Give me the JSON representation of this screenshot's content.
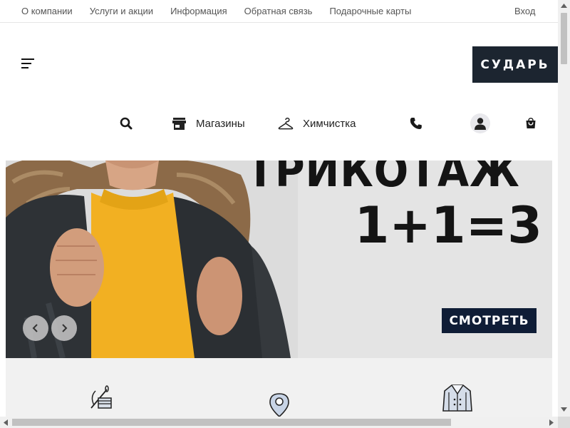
{
  "topnav": {
    "items": [
      {
        "label": "О компании"
      },
      {
        "label": "Услуги и акции"
      },
      {
        "label": "Информация"
      },
      {
        "label": "Обратная связь"
      },
      {
        "label": "Подарочные карты"
      }
    ],
    "login_label": "Вход"
  },
  "header": {
    "logo_text": "СУДАРЬ",
    "menu_icon": "hamburger-menu-icon"
  },
  "icon_bar": {
    "search_icon": "search-icon",
    "stores_label": "Магазины",
    "stores_icon": "store-icon",
    "cleaning_label": "Химчистка",
    "cleaning_icon": "hanger-icon",
    "phone_icon": "phone-icon",
    "profile_icon": "user-avatar-icon",
    "cart_icon": "shopping-bag-icon"
  },
  "hero": {
    "title": "ТРИКОТАЖ",
    "promo": "1+1=3",
    "button_label": "СМОТРЕТЬ",
    "prev_icon": "chevron-left-icon",
    "next_icon": "chevron-right-icon"
  },
  "features": {
    "icons": [
      "sewing-needle-icon",
      "map-pin-icon",
      "coat-icon"
    ]
  },
  "colors": {
    "logo_bg": "#1c2530",
    "button_bg": "#0f1d36",
    "hero_bg": "#e4e4e4",
    "sweater": "#f2b022",
    "features_bg": "#f1f1f1"
  }
}
